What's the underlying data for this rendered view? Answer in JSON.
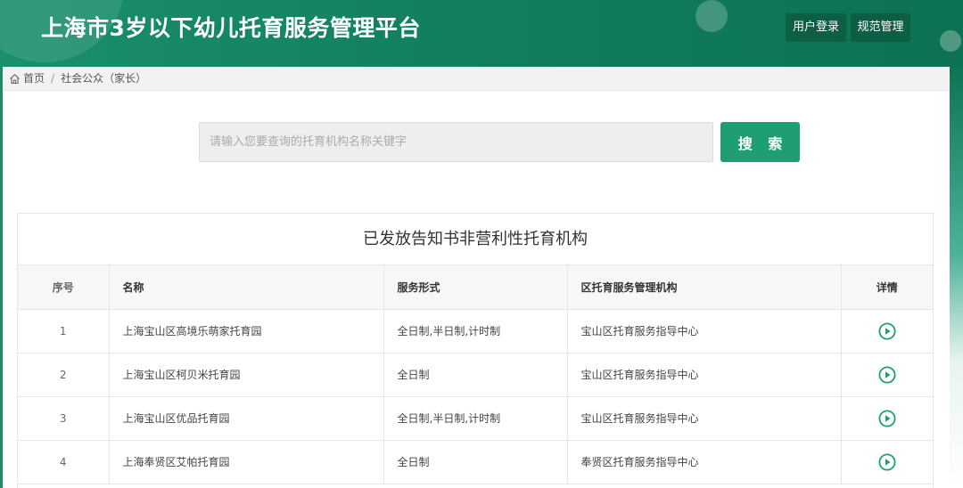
{
  "header": {
    "app_title": "上海市3岁以下幼儿托育服务管理平台",
    "login_label": "用户登录",
    "manage_label": "规范管理"
  },
  "breadcrumb": {
    "home_label": "首页",
    "separator": "/",
    "current_label": "社会公众（家长）"
  },
  "search": {
    "placeholder": "请输入您要查询的托育机构名称关键字",
    "value": "",
    "button_label": "搜 索"
  },
  "table": {
    "title": "已发放告知书非营利性托育机构",
    "columns": [
      "序号",
      "名称",
      "服务形式",
      "区托育服务管理机构",
      "详情"
    ],
    "rows": [
      {
        "index": "1",
        "name": "上海宝山区高境乐萌家托育园",
        "service": "全日制,半日制,计时制",
        "district": "宝山区托育服务指导中心"
      },
      {
        "index": "2",
        "name": "上海宝山区柯贝米托育园",
        "service": "全日制",
        "district": "宝山区托育服务指导中心"
      },
      {
        "index": "3",
        "name": "上海宝山区优品托育园",
        "service": "全日制,半日制,计时制",
        "district": "宝山区托育服务指导中心"
      },
      {
        "index": "4",
        "name": "上海奉贤区艾帕托育园",
        "service": "全日制",
        "district": "奉贤区托育服务指导中心"
      }
    ]
  },
  "icons": {
    "home": "home-icon",
    "detail": "play-circle-icon"
  },
  "colors": {
    "brand": "#128060",
    "button_dark": "#0c5e45",
    "accent": "#1f9e74"
  }
}
